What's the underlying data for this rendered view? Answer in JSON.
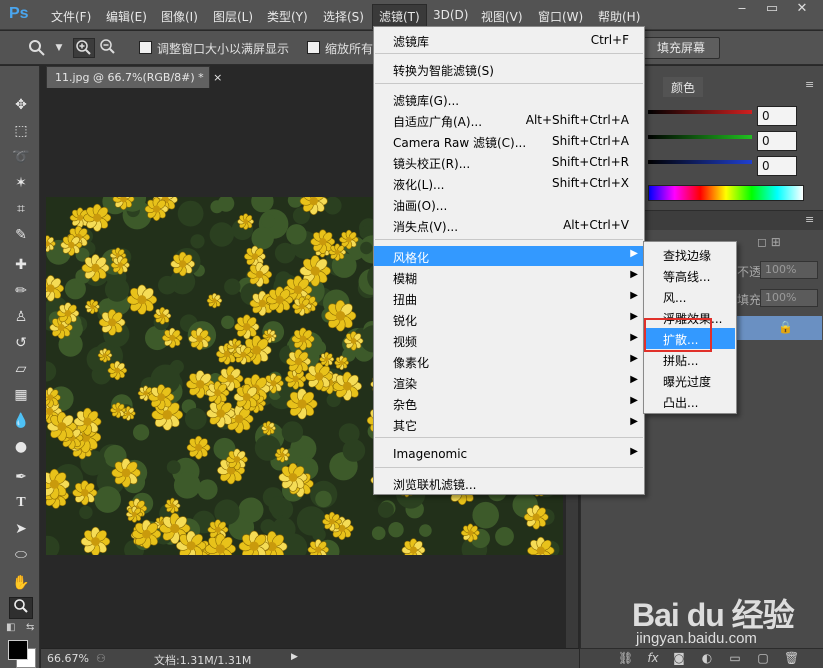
{
  "app": {
    "logo": "Ps",
    "menus": [
      "文件(F)",
      "编辑(E)",
      "图像(I)",
      "图层(L)",
      "类型(Y)",
      "选择(S)",
      "滤镜(T)",
      "3D(D)",
      "视图(V)",
      "窗口(W)",
      "帮助(H)"
    ],
    "active_menu_index": 6,
    "window_buttons": [
      "‒",
      "▭",
      "✕"
    ]
  },
  "options_bar": {
    "resize_windows_label": "调整窗口大小以满屏显示",
    "zoom_all_label": "缩放所有",
    "fill_screen_label": "填充屏幕"
  },
  "document": {
    "tab_title": "11.jpg @ 66.7%(RGB/8#) *",
    "tab_close": "×",
    "zoom": "66.67%",
    "doc_size": "文档:1.31M/1.31M"
  },
  "filter_menu": {
    "items": [
      {
        "label": "滤镜库",
        "shortcut": "Ctrl+F"
      },
      {
        "label": "转换为智能滤镜(S)"
      },
      {
        "label": "滤镜库(G)..."
      },
      {
        "label": "自适应广角(A)...",
        "shortcut": "Alt+Shift+Ctrl+A"
      },
      {
        "label": "Camera Raw 滤镜(C)...",
        "shortcut": "Shift+Ctrl+A"
      },
      {
        "label": "镜头校正(R)...",
        "shortcut": "Shift+Ctrl+R"
      },
      {
        "label": "液化(L)...",
        "shortcut": "Shift+Ctrl+X"
      },
      {
        "label": "油画(O)..."
      },
      {
        "label": "消失点(V)...",
        "shortcut": "Alt+Ctrl+V"
      },
      {
        "label": "风格化",
        "submenu": true,
        "highlighted": true
      },
      {
        "label": "模糊",
        "submenu": true
      },
      {
        "label": "扭曲",
        "submenu": true
      },
      {
        "label": "锐化",
        "submenu": true
      },
      {
        "label": "视频",
        "submenu": true
      },
      {
        "label": "像素化",
        "submenu": true
      },
      {
        "label": "渲染",
        "submenu": true
      },
      {
        "label": "杂色",
        "submenu": true
      },
      {
        "label": "其它",
        "submenu": true
      },
      {
        "label": "Imagenomic",
        "submenu": true
      },
      {
        "label": "浏览联机滤镜..."
      }
    ]
  },
  "stylize_submenu": {
    "items": [
      "查找边缘",
      "等高线...",
      "风...",
      "浮雕效果...",
      "扩散...",
      "拼贴...",
      "曝光过度",
      "凸出..."
    ],
    "highlighted_index": 4
  },
  "color_panel": {
    "tab": "颜色",
    "values": [
      "0",
      "0",
      "0"
    ],
    "slider_colors": [
      "#d02020",
      "#20c020",
      "#2040d0"
    ]
  },
  "layers_panel": {
    "opacity_label": "不透明度:",
    "opacity_value": "100%",
    "fill_label": "填充:",
    "fill_value": "100%"
  },
  "watermark": {
    "brand": "Bai du 经验",
    "url": "jingyan.baidu.com"
  }
}
